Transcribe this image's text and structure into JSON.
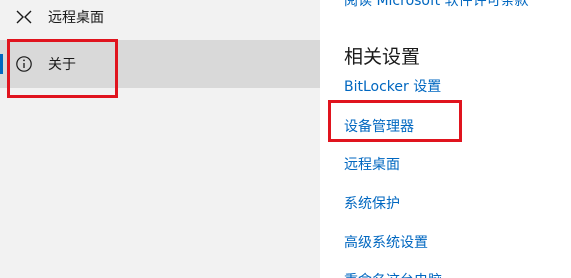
{
  "sidebar": {
    "items": [
      {
        "label": "远程桌面",
        "icon": "remote-desktop-icon"
      },
      {
        "label": "关于",
        "icon": "info-icon",
        "selected": true
      }
    ]
  },
  "main": {
    "top_link_partial": "阅读 Microsoft 软件许可条款",
    "related_settings": {
      "title": "相关设置",
      "links": [
        "BitLocker 设置",
        "设备管理器",
        "远程桌面",
        "系统保护",
        "高级系统设置",
        "重命名这台电脑"
      ]
    }
  },
  "colors": {
    "sidebar_bg": "#f2f2f2",
    "selected_bg": "#d9d9d9",
    "accent": "#0067c0",
    "highlight_box": "#e0141e"
  }
}
